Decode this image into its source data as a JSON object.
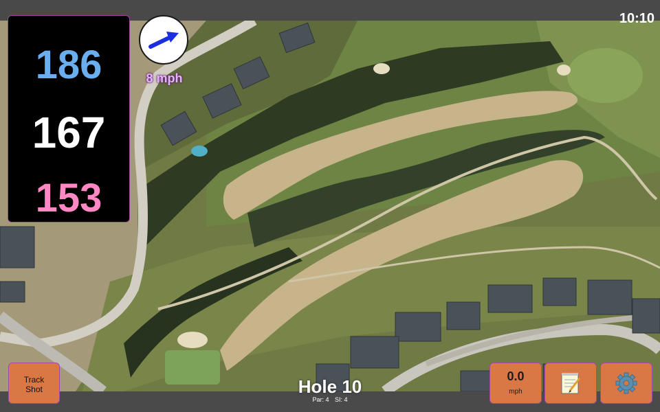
{
  "status_bar": {
    "time": "10:10"
  },
  "distances": {
    "back": "186",
    "middle": "167",
    "front": "153",
    "colors": {
      "back": "#6aaef0",
      "middle": "#ffffff",
      "front": "#ff87c3"
    }
  },
  "wind": {
    "icon": "wind-direction-arrow-icon",
    "speed": "8 mph"
  },
  "buttons": {
    "track_shot_line1": "Track",
    "track_shot_line2": "Shot",
    "speed_value": "0.0",
    "speed_unit": "mph",
    "notes_icon": "notepad-icon",
    "settings_icon": "gear-icon"
  },
  "hole": {
    "title": "Hole 10",
    "par": "Par: 4",
    "si": "SI: 4"
  },
  "map": {
    "type": "satellite",
    "accent_color": "#d97845"
  }
}
